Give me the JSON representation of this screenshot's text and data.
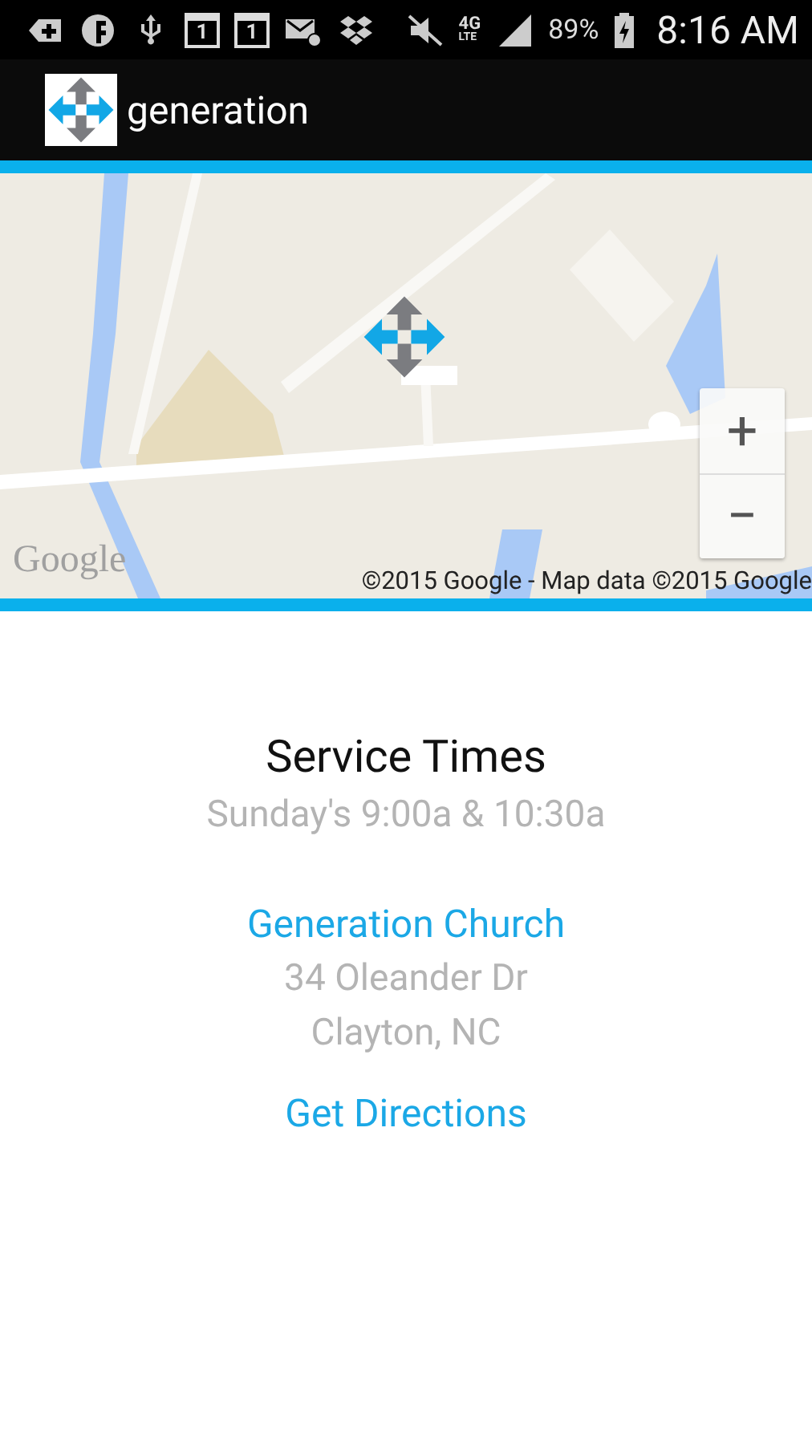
{
  "status_bar": {
    "notifications": [
      {
        "kind": "add"
      },
      {
        "kind": "app"
      },
      {
        "kind": "usb"
      },
      {
        "kind": "calendar",
        "day": "1"
      },
      {
        "kind": "calendar",
        "day": "1"
      },
      {
        "kind": "mail"
      },
      {
        "kind": "dropbox"
      }
    ],
    "network": {
      "type": "4G",
      "sub": "LTE"
    },
    "battery": "89%",
    "time": "8:16 AM"
  },
  "app_bar": {
    "title": "generation"
  },
  "map": {
    "kind": "picture",
    "zoom_in": "+",
    "zoom_out": "−",
    "logo": "Google",
    "attribution": "©2015 Google - Map data ©2015 Google"
  },
  "service": {
    "heading": "Service Times",
    "times": "Sunday's 9:00a & 10:30a"
  },
  "location": {
    "name": "Generation Church",
    "address_lines": [
      "34 Oleander Dr",
      "Clayton, NC"
    ],
    "directions": "Get Directions"
  }
}
